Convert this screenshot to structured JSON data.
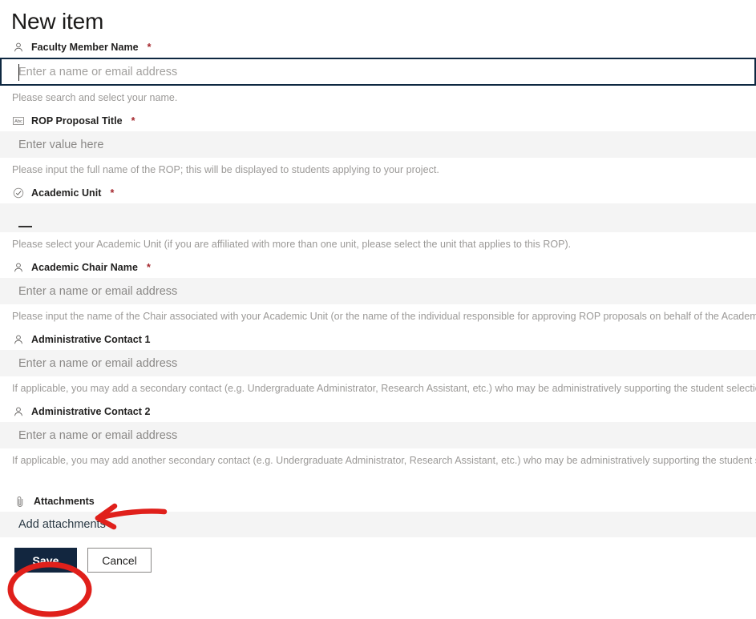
{
  "page": {
    "title": "New item"
  },
  "fields": [
    {
      "key": "faculty_member_name",
      "icon": "person-icon",
      "label": "Faculty Member Name",
      "required": true,
      "required_mark": "*",
      "placeholder": "Enter a name or email address",
      "value": "",
      "focused": true,
      "helper": "Please search and select your name."
    },
    {
      "key": "rop_proposal_title",
      "icon": "abc-text-icon",
      "label": "ROP Proposal Title",
      "required": true,
      "required_mark": "*",
      "placeholder": "Enter value here",
      "value": "",
      "focused": false,
      "helper": "Please input the full name of the ROP; this will be displayed to students applying to your project."
    },
    {
      "key": "academic_unit",
      "icon": "check-circle-icon",
      "label": "Academic Unit",
      "required": true,
      "required_mark": "*",
      "placeholder": "—",
      "value": "",
      "focused": false,
      "helper": "Please select your Academic Unit (if you are affiliated with more than one unit, please select the unit that applies to this ROP)."
    },
    {
      "key": "academic_chair_name",
      "icon": "person-icon",
      "label": "Academic Chair Name",
      "required": true,
      "required_mark": "*",
      "placeholder": "Enter a name or email address",
      "value": "",
      "focused": false,
      "helper": "Please input the name of the Chair associated with your Academic Unit (or the name of the individual responsible for approving ROP proposals on behalf of the Academic Unit)."
    },
    {
      "key": "administrative_contact_1",
      "icon": "person-icon",
      "label": "Administrative Contact 1",
      "required": false,
      "required_mark": "",
      "placeholder": "Enter a name or email address",
      "value": "",
      "focused": false,
      "helper": "If applicable, you may add a secondary contact (e.g. Undergraduate Administrator, Research Assistant, etc.) who may be administratively supporting the student selection and co"
    },
    {
      "key": "administrative_contact_2",
      "icon": "person-icon",
      "label": "Administrative Contact 2",
      "required": false,
      "required_mark": "",
      "placeholder": "Enter a name or email address",
      "value": "",
      "focused": false,
      "helper": "If applicable, you may add another secondary contact (e.g. Undergraduate Administrator, Research Assistant, etc.) who may be administratively supporting the student selection"
    }
  ],
  "attachments": {
    "icon": "paperclip-icon",
    "label": "Attachments",
    "add_label": "Add attachments"
  },
  "actions": {
    "save_label": "Save",
    "cancel_label": "Cancel"
  },
  "annotations": {
    "color": "#e0201b",
    "arrow_target": "Attachments",
    "circle_target": "Save"
  },
  "colors": {
    "save_button_bg": "#12263f",
    "focus_border": "#0e2841",
    "input_bg": "#f4f4f4",
    "required_star": "#a4262c",
    "annotation_red": "#e0201b"
  }
}
